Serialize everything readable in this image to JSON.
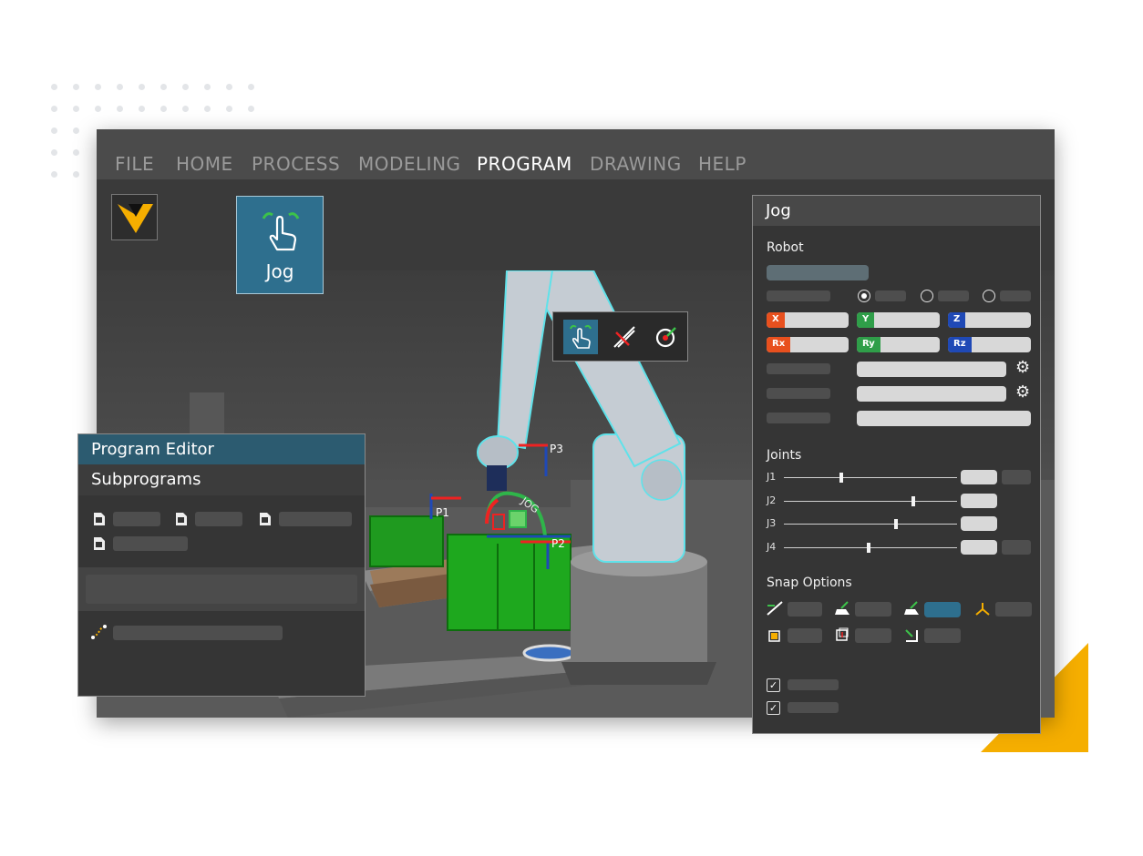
{
  "menu": {
    "items": [
      {
        "label": "FILE"
      },
      {
        "label": "HOME"
      },
      {
        "label": "PROCESS"
      },
      {
        "label": "MODELING"
      },
      {
        "label": "PROGRAM",
        "active": true
      },
      {
        "label": "DRAWING"
      },
      {
        "label": "HELP"
      }
    ]
  },
  "ribbon": {
    "jog_label": "Jog"
  },
  "viewport": {
    "labels": {
      "p1": "P1",
      "p2": "P2",
      "p3": "P3",
      "jog_gizmo": "JOG"
    },
    "toolbar": [
      {
        "icon": "hand-pointer-icon",
        "active": true
      },
      {
        "icon": "align-icon",
        "active": false
      },
      {
        "icon": "target-icon",
        "active": false
      }
    ]
  },
  "program_editor": {
    "title": "Program Editor",
    "subprograms_label": "Subprograms"
  },
  "jog_panel": {
    "title": "Jog",
    "robot_label": "Robot",
    "axis_tags": [
      "X",
      "Y",
      "Z",
      "Rx",
      "Ry",
      "Rz"
    ],
    "joints_label": "Joints",
    "joints": [
      {
        "label": "J1",
        "value": 0.33
      },
      {
        "label": "J2",
        "value": 0.75
      },
      {
        "label": "J3",
        "value": 0.65
      },
      {
        "label": "J4",
        "value": 0.49
      }
    ],
    "snap_label": "Snap Options"
  },
  "colors": {
    "accent_blue": "#2e6f8e",
    "x_axis": "#e8501e",
    "y_axis": "#2f9e49",
    "z_axis": "#1f49b6",
    "brand_yellow": "#f5ae00"
  }
}
